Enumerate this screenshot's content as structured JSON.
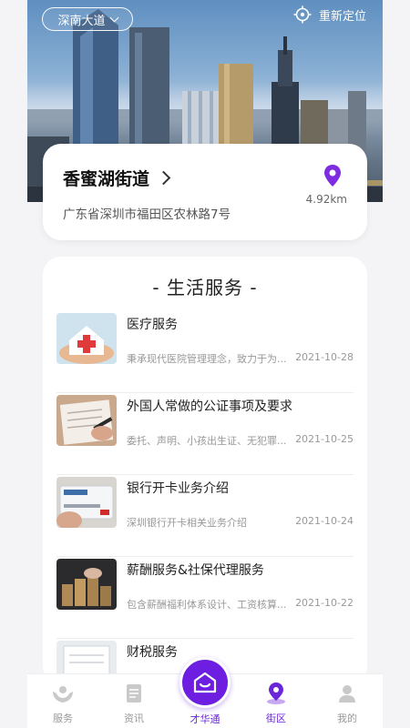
{
  "header": {
    "district": "深南大道",
    "relocate_label": "重新定位"
  },
  "location": {
    "street": "香蜜湖街道",
    "address": "广东省深圳市福田区农林路7号",
    "distance": "4.92km"
  },
  "services": {
    "title": "- 生活服务 -",
    "items": [
      {
        "title": "医疗服务",
        "desc": "秉承现代医院管理理念，致力于为...",
        "date": "2021-10-28",
        "thumb": "medical-cross-image"
      },
      {
        "title": "外国人常做的公证事项及要求",
        "desc": "委托、声明、小孩出生证、无犯罪...",
        "date": "2021-10-25",
        "thumb": "signing-document-image"
      },
      {
        "title": "银行开卡业务介绍",
        "desc": "深圳银行开卡相关业务介绍",
        "date": "2021-10-24",
        "thumb": "bank-card-image"
      },
      {
        "title": "薪酬服务&社保代理服务",
        "desc": "包含薪酬福利体系设计、工资核算...",
        "date": "2021-10-22",
        "thumb": "coin-stacks-image"
      },
      {
        "title": "财税服务",
        "desc": "",
        "date": "",
        "thumb": "tax-document-image"
      }
    ]
  },
  "tabbar": {
    "tabs": [
      {
        "label": "服务",
        "icon": "hands-icon"
      },
      {
        "label": "资讯",
        "icon": "news-icon"
      },
      {
        "label": "才华通",
        "icon": "home-smile-icon"
      },
      {
        "label": "街区",
        "icon": "location-pin-icon"
      },
      {
        "label": "我的",
        "icon": "person-icon"
      }
    ]
  },
  "colors": {
    "accent": "#6a26d9",
    "pin": "#7d2cdf",
    "background": "#f4f4f6"
  }
}
